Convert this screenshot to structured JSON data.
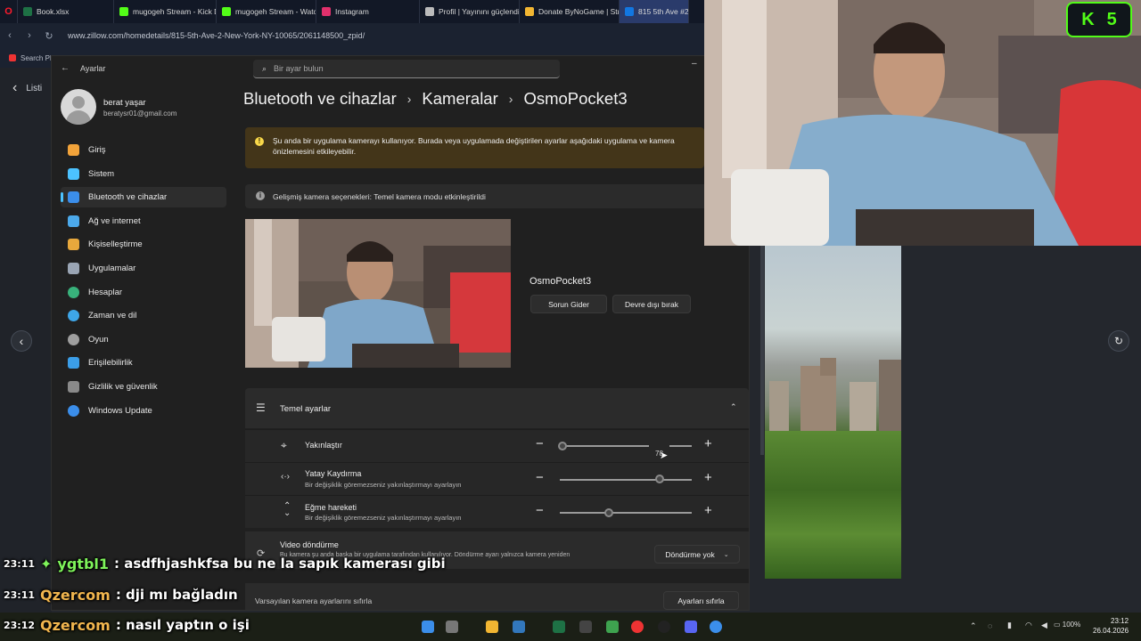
{
  "browser": {
    "tabs": [
      {
        "label": "Book.xlsx",
        "color": "#1e7145",
        "icon": "excel-icon"
      },
      {
        "label": "mugogeh Stream - Kick D",
        "color": "#53fc18",
        "icon": "kick-icon"
      },
      {
        "label": "mugogeh Stream - Watch",
        "color": "#53fc18",
        "icon": "kick-icon"
      },
      {
        "label": "Instagram",
        "color": "#e1306c",
        "icon": "instagram-icon"
      },
      {
        "label": "Profil | Yayınını güçlendir",
        "color": "#bbbbbb",
        "icon": "shield-icon"
      },
      {
        "label": "Donate ByNoGame | Strea",
        "color": "#f2b632",
        "icon": "coin-icon"
      },
      {
        "label": "815 5th Ave #2, N",
        "color": "#1277e1",
        "icon": "zillow-icon"
      }
    ],
    "url": "www.zillow.com/homedetails/815-5th-Ave-2-New-York-NY-10065/2061148500_zpid/",
    "bookmark_item": "Search PH"
  },
  "zillow": {
    "list_label": "Listi"
  },
  "settings": {
    "app_title": "Ayarlar",
    "search_placeholder": "Bir ayar bulun",
    "user": {
      "name": "berat yaşar",
      "email": "beratysr01@gmail.com"
    },
    "nav": [
      {
        "label": "Giriş",
        "icon": "home-icon",
        "color": "#f2a33a"
      },
      {
        "label": "Sistem",
        "icon": "monitor-icon",
        "color": "#4cc2ff"
      },
      {
        "label": "Bluetooth ve cihazlar",
        "icon": "bluetooth-icon",
        "color": "#3b8eea",
        "selected": true
      },
      {
        "label": "Ağ ve internet",
        "icon": "wifi-icon",
        "color": "#4ca9ea"
      },
      {
        "label": "Kişiselleştirme",
        "icon": "brush-icon",
        "color": "#e8a83c"
      },
      {
        "label": "Uygulamalar",
        "icon": "apps-icon",
        "color": "#9aa5b4"
      },
      {
        "label": "Hesaplar",
        "icon": "person-icon",
        "color": "#38b27b"
      },
      {
        "label": "Zaman ve dil",
        "icon": "globe-icon",
        "color": "#3ea6e8"
      },
      {
        "label": "Oyun",
        "icon": "gamepad-icon",
        "color": "#9e9e9e"
      },
      {
        "label": "Erişilebilirlik",
        "icon": "accessibility-icon",
        "color": "#3b9ee8"
      },
      {
        "label": "Gizlilik ve güvenlik",
        "icon": "shield-icon",
        "color": "#8a8a8a"
      },
      {
        "label": "Windows Update",
        "icon": "update-icon",
        "color": "#3b8eea"
      }
    ],
    "breadcrumb": [
      "Bluetooth ve cihazlar",
      "Kameralar",
      "OsmoPocket3"
    ],
    "breadcrumb_sep": "›",
    "warning": "Şu anda bir uygulama kamerayı kullanıyor. Burada veya başka uygulamada değiştirilen ayarlar aşağıdaki uygulama ve kamera önizlemesini etkileyebilir.",
    "warning_line1": "Şu anda bir uygulama kamerayı kullanıyor. Burada veya uygulamada değiştirilen ayarlar aşağıdaki uygulama ve kamera",
    "warning_line2": "önizlemesini etkileyebilir.",
    "info": "Gelişmiş kamera seçenekleri: Temel kamera modu etkinleştirildi",
    "camera_name": "OsmoPocket3",
    "troubleshoot_button": "Sorun Gider",
    "disable_button": "Devre dışı bırak",
    "basic_settings_title": "Temel ayarlar",
    "rows": [
      {
        "label": "Yakınlaştır",
        "sub": "",
        "value": 0.02,
        "tooltip": "78"
      },
      {
        "label": "Yatay Kaydırma",
        "sub": "Bir değişiklik göremezseniz yakınlaştırmayı ayarlayın",
        "value": 0.76
      },
      {
        "label": "Eğme hareketi",
        "sub": "Bir değişiklik göremezseniz yakınlaştırmayı ayarlayın",
        "value": 0.37
      }
    ],
    "video_rotation_label": "Video döndürme",
    "video_rotation_sub": "Bu kamera şu anda başka bir uygulama tarafından kullanılıyor. Döndürme ayarı yalnızca kamera yeniden",
    "video_rotation_value": "Döndürme yok",
    "reset_label": "Varsayılan kamera ayarlarını sıfırla",
    "reset_button": "Ayarları sıfırla"
  },
  "kick_badge": {
    "letter": "K",
    "count": "5"
  },
  "chat": [
    {
      "time": "23:11",
      "user": "ygtbl1",
      "user_color": "#7ef35a",
      "msg": ": asdfhjashkfsa bu ne la sapık kamerası gibi",
      "badge": true
    },
    {
      "time": "23:11",
      "user": "Qzercom",
      "user_color": "#f0b54e",
      "msg": ": dji mı bağladın"
    },
    {
      "time": "23:12",
      "user": "Qzercom",
      "user_color": "#f0b54e",
      "msg": ": nasıl yaptın o işi"
    }
  ],
  "taskbar": {
    "time": "23:12",
    "date": "26.04.2026",
    "battery": "100%"
  }
}
